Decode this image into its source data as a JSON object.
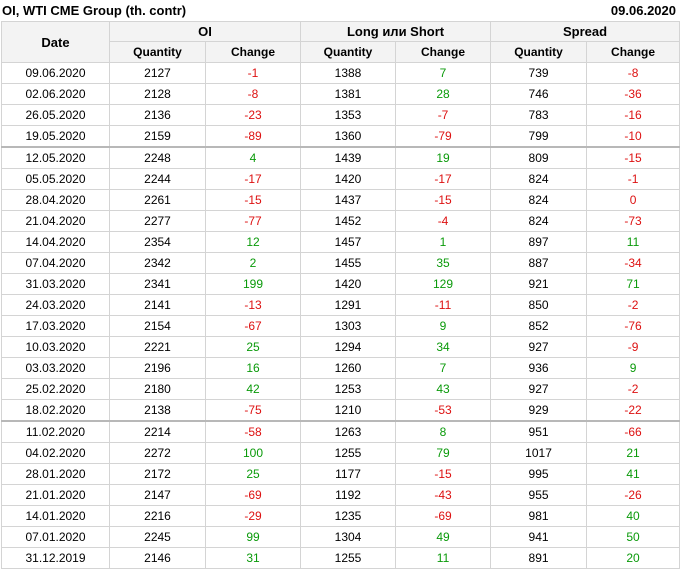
{
  "header": {
    "title": "OI, WTI CME Group (th. contr)",
    "date": "09.06.2020"
  },
  "columns": {
    "date": "Date",
    "groups": [
      "OI",
      "Long или Short",
      "Spread"
    ],
    "sub": [
      "Quantity",
      "Change",
      "Quantity",
      "Change",
      "Quantity",
      "Change"
    ]
  },
  "colors": {
    "positive": "#0a9a0a",
    "negative": "#dd1111"
  },
  "rows": [
    [
      "09.06.2020",
      "2127",
      "-1",
      "1388",
      "7",
      "739",
      "-8"
    ],
    [
      "02.06.2020",
      "2128",
      "-8",
      "1381",
      "28",
      "746",
      "-36"
    ],
    [
      "26.05.2020",
      "2136",
      "-23",
      "1353",
      "-7",
      "783",
      "-16"
    ],
    [
      "19.05.2020",
      "2159",
      "-89",
      "1360",
      "-79",
      "799",
      "-10"
    ],
    [
      "12.05.2020",
      "2248",
      "4",
      "1439",
      "19",
      "809",
      "-15"
    ],
    [
      "05.05.2020",
      "2244",
      "-17",
      "1420",
      "-17",
      "824",
      "-1"
    ],
    [
      "28.04.2020",
      "2261",
      "-15",
      "1437",
      "-15",
      "824",
      "0"
    ],
    [
      "21.04.2020",
      "2277",
      "-77",
      "1452",
      "-4",
      "824",
      "-73"
    ],
    [
      "14.04.2020",
      "2354",
      "12",
      "1457",
      "1",
      "897",
      "11"
    ],
    [
      "07.04.2020",
      "2342",
      "2",
      "1455",
      "35",
      "887",
      "-34"
    ],
    [
      "31.03.2020",
      "2341",
      "199",
      "1420",
      "129",
      "921",
      "71"
    ],
    [
      "24.03.2020",
      "2141",
      "-13",
      "1291",
      "-11",
      "850",
      "-2"
    ],
    [
      "17.03.2020",
      "2154",
      "-67",
      "1303",
      "9",
      "852",
      "-76"
    ],
    [
      "10.03.2020",
      "2221",
      "25",
      "1294",
      "34",
      "927",
      "-9"
    ],
    [
      "03.03.2020",
      "2196",
      "16",
      "1260",
      "7",
      "936",
      "9"
    ],
    [
      "25.02.2020",
      "2180",
      "42",
      "1253",
      "43",
      "927",
      "-2"
    ],
    [
      "18.02.2020",
      "2138",
      "-75",
      "1210",
      "-53",
      "929",
      "-22"
    ],
    [
      "11.02.2020",
      "2214",
      "-58",
      "1263",
      "8",
      "951",
      "-66"
    ],
    [
      "04.02.2020",
      "2272",
      "100",
      "1255",
      "79",
      "1017",
      "21"
    ],
    [
      "28.01.2020",
      "2172",
      "25",
      "1177",
      "-15",
      "995",
      "41"
    ],
    [
      "21.01.2020",
      "2147",
      "-69",
      "1192",
      "-43",
      "955",
      "-26"
    ],
    [
      "14.01.2020",
      "2216",
      "-29",
      "1235",
      "-69",
      "981",
      "40"
    ],
    [
      "07.01.2020",
      "2245",
      "99",
      "1304",
      "49",
      "941",
      "50"
    ],
    [
      "31.12.2019",
      "2146",
      "31",
      "1255",
      "11",
      "891",
      "20"
    ]
  ],
  "separator_before_rows": [
    4,
    17
  ]
}
